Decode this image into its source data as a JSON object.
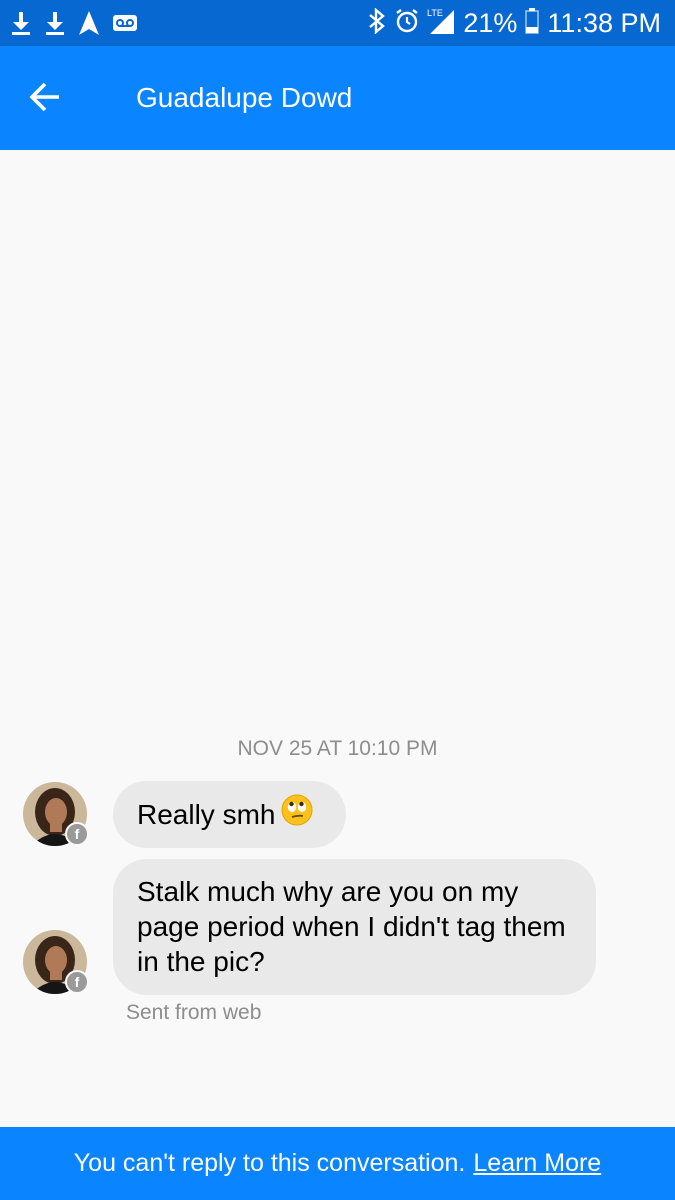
{
  "status_bar": {
    "left_icons": [
      "download-icon",
      "download-icon",
      "navigation-icon",
      "voicemail-icon"
    ],
    "right_icons": [
      "bluetooth-icon",
      "alarm-icon",
      "lte-signal-icon",
      "battery-icon"
    ],
    "network_label": "LTE",
    "battery_percent": "21%",
    "time": "11:38 PM"
  },
  "header": {
    "back_icon": "arrow-left-icon",
    "contact_name": "Guadalupe Dowd"
  },
  "thread": {
    "timestamp": "NOV 25 AT 10:10 PM",
    "messages": [
      {
        "text": "Really smh",
        "emoji": "rolling-eyes-emoji",
        "avatar_badge": "f"
      },
      {
        "text": "Stalk much why are you on my page period when I didn't tag them in the pic?",
        "avatar_badge": "f"
      }
    ],
    "sent_from": "Sent from web"
  },
  "footer": {
    "notice": "You can't reply to this conversation.",
    "link": "Learn More"
  },
  "colors": {
    "status_bar": "#0868d2",
    "app_bar": "#0a84ff",
    "bubble": "#e9e9e9",
    "background": "#f9f9f9",
    "muted_text": "#8d8d8d"
  }
}
